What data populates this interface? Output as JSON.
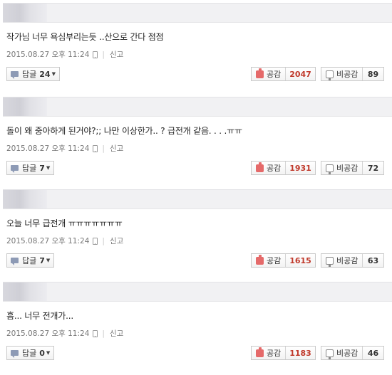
{
  "comments": [
    {
      "text": "작가님 너무 욕심부리는듯 ..산으로 간다 점점",
      "date": "2015.08.27 오후 11:24",
      "report_label": "신고",
      "reply_label": "답글",
      "reply_count": "24",
      "like_label": "공감",
      "like_count": "2047",
      "dislike_label": "비공감",
      "dislike_count": "89"
    },
    {
      "text": "돌이 왜 중아하게 된거야?;; 나만 이상한가.. ? 급전개 같음. . . .ㅠㅠ",
      "date": "2015.08.27 오후 11:24",
      "report_label": "신고",
      "reply_label": "답글",
      "reply_count": "7",
      "like_label": "공감",
      "like_count": "1931",
      "dislike_label": "비공감",
      "dislike_count": "72"
    },
    {
      "text": "오늘 너무 급전개 ㅠㅠㅠㅠㅠㅠㅠ",
      "date": "2015.08.27 오후 11:24",
      "report_label": "신고",
      "reply_label": "답글",
      "reply_count": "7",
      "like_label": "공감",
      "like_count": "1615",
      "dislike_label": "비공감",
      "dislike_count": "63"
    },
    {
      "text": "흠... 너무 전개가...",
      "date": "2015.08.27 오후 11:24",
      "report_label": "신고",
      "reply_label": "답글",
      "reply_count": "0",
      "like_label": "공감",
      "like_count": "1183",
      "dislike_label": "비공감",
      "dislike_count": "46"
    }
  ],
  "colors": {
    "like_count": "#c0392b",
    "header_bg": "#f1f1f3"
  },
  "icons": {
    "reply": "speech-bubble-icon",
    "like": "thumbs-up-icon",
    "dislike": "thumbs-down-icon",
    "mobile": "mobile-phone-icon",
    "dropdown": "caret-down-icon"
  }
}
